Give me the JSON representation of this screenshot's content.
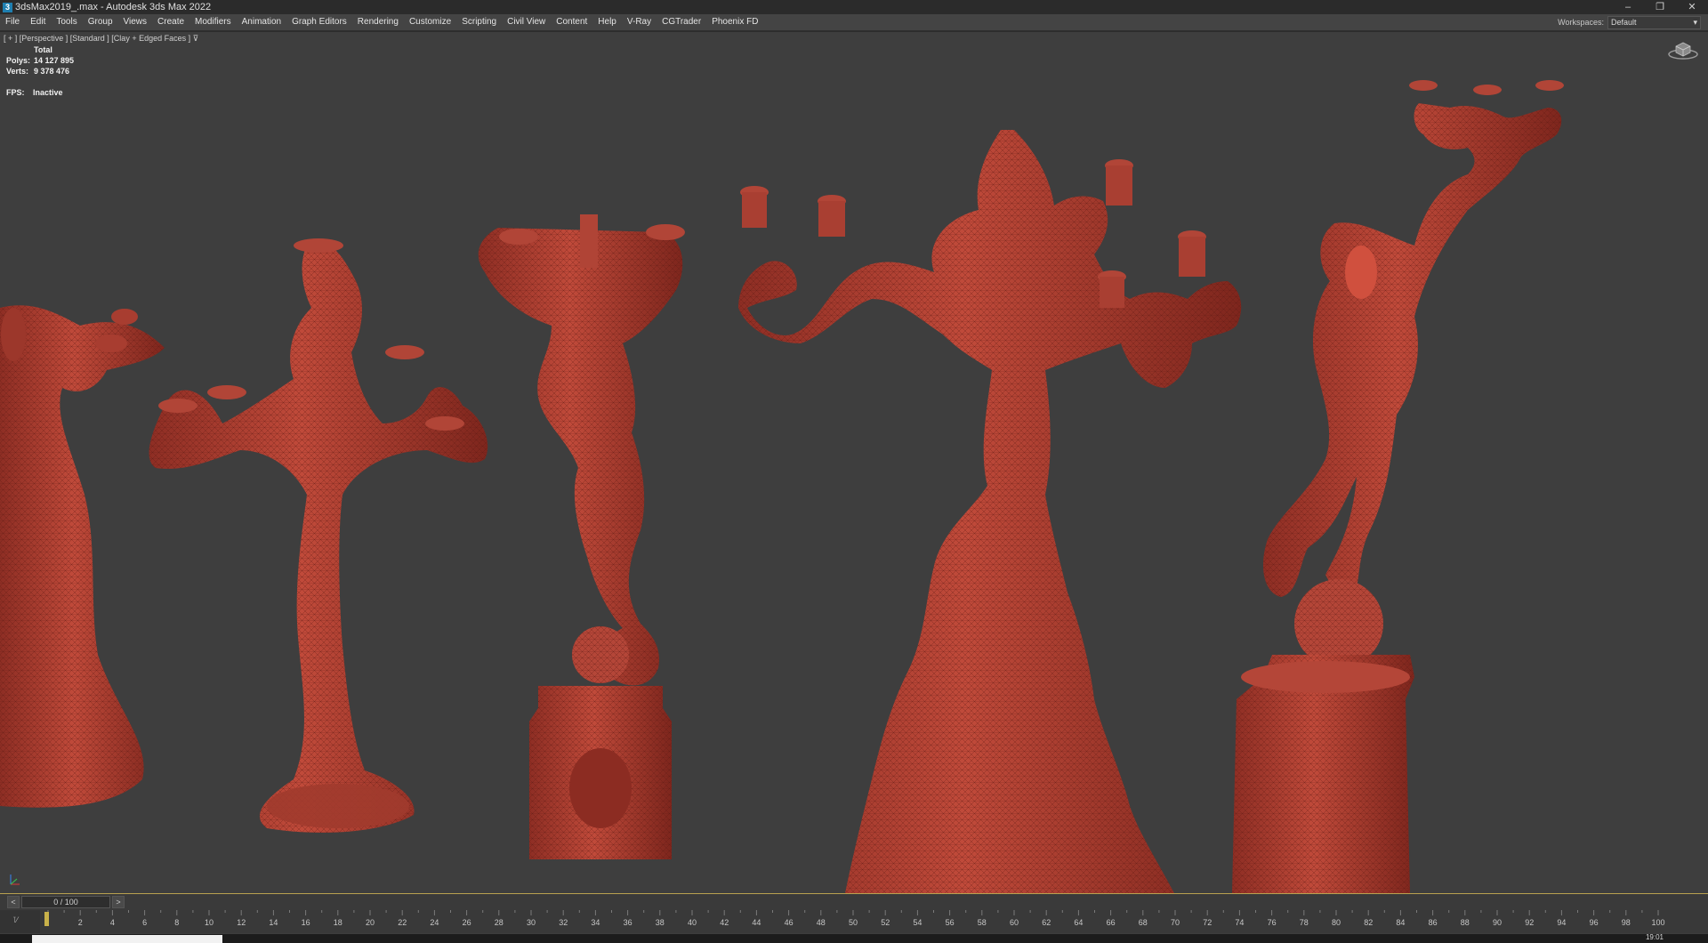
{
  "window": {
    "title": "3dsMax2019_.max - Autodesk 3ds Max 2022",
    "app_icon": "3",
    "controls": [
      "–",
      "❐",
      "✕"
    ]
  },
  "menu": {
    "items": [
      "File",
      "Edit",
      "Tools",
      "Group",
      "Views",
      "Create",
      "Modifiers",
      "Animation",
      "Graph Editors",
      "Rendering",
      "Customize",
      "Scripting",
      "Civil View",
      "Content",
      "Help",
      "V-Ray",
      "CGTrader",
      "Phoenix FD"
    ],
    "workspaces_label": "Workspaces:",
    "workspaces_value": "Default"
  },
  "viewport": {
    "label": "[ + ]  [Perspective ]  [Standard ]  [Clay + Edged Faces ]  ",
    "filter_icon": "funnel-icon",
    "stats": {
      "header": "Total",
      "polys_label": "Polys:",
      "polys": "14 127 895",
      "verts_label": "Verts:",
      "verts": "9 378 476",
      "fps_label": "FPS:",
      "fps": "Inactive"
    },
    "model_color": "#b84436",
    "model_shadow": "#6e1f18"
  },
  "timeslider": {
    "prev": "<",
    "next": ">",
    "label": "0 / 100"
  },
  "trackbar": {
    "ticks": [
      "2",
      "4",
      "6",
      "8",
      "10",
      "12",
      "14",
      "16",
      "18",
      "20",
      "22",
      "24",
      "26",
      "28",
      "30",
      "32",
      "34",
      "36",
      "38",
      "40",
      "42",
      "44",
      "46",
      "48",
      "50",
      "52",
      "54",
      "56",
      "58",
      "60",
      "62",
      "64",
      "66",
      "68",
      "70",
      "72",
      "74",
      "76",
      "78",
      "80",
      "82",
      "84",
      "86",
      "88",
      "90",
      "92",
      "94",
      "96",
      "98",
      "100"
    ],
    "current_frame": 0
  },
  "taskbar": {
    "clock": "19:01"
  }
}
